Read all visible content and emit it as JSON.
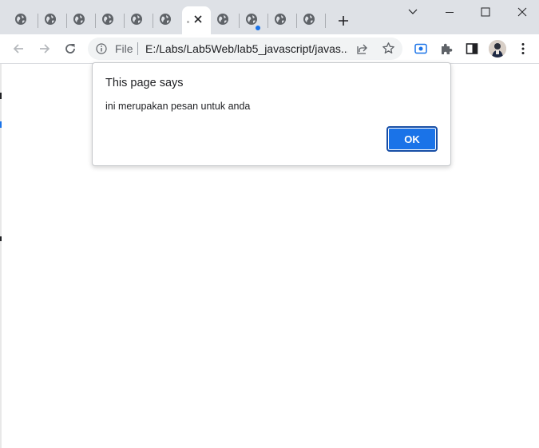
{
  "browser": {
    "tabs": [
      {
        "icon": "globe-icon"
      },
      {
        "icon": "globe-icon"
      },
      {
        "icon": "globe-icon"
      },
      {
        "icon": "globe-icon"
      },
      {
        "icon": "globe-icon"
      },
      {
        "icon": "globe-icon"
      },
      {
        "icon": "globe-icon",
        "active": true
      },
      {
        "icon": "globe-icon"
      },
      {
        "icon": "globe-icon",
        "notification_dot": true
      },
      {
        "icon": "globe-icon"
      },
      {
        "icon": "globe-icon"
      }
    ],
    "address": {
      "scheme_label": "File",
      "url": "E:/Labs/Lab5Web/lab5_javascript/javas..."
    },
    "colors": {
      "accent": "#1a73e8",
      "titlebar": "#dee1e6"
    }
  },
  "dialog": {
    "title": "This page says",
    "message": "ini merupakan pesan untuk anda",
    "ok_label": "OK"
  }
}
